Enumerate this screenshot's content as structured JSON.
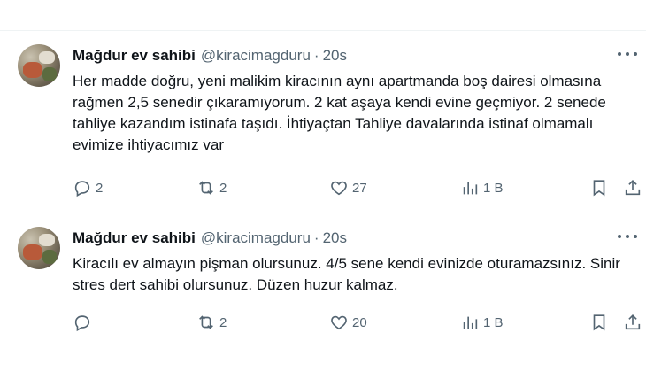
{
  "tweets": [
    {
      "name": "Mağdur ev sahibi",
      "handle": "@kiracimagduru",
      "separator": "·",
      "time": "20s",
      "text": "Her madde doğru, yeni malikim kiracının aynı apartmanda boş dairesi olmasına rağmen 2,5 senedir çıkaramıyorum. 2 kat aşaya kendi evine geçmiyor. 2 senede tahliye kazandım istinafa taşıdı. İhtiyaçtan Tahliye davalarında istinaf olmamalı evimize ihtiyacımız var",
      "replies": "2",
      "retweets": "2",
      "likes": "27",
      "views": "1 B"
    },
    {
      "name": "Mağdur ev sahibi",
      "handle": "@kiracimagduru",
      "separator": "·",
      "time": "20s",
      "text": "Kiracılı ev almayın pişman olursunuz. 4/5 sene kendi evinizde oturamazsınız. Sinir stres dert sahibi olursunuz. Düzen huzur kalmaz.",
      "replies": "",
      "retweets": "2",
      "likes": "20",
      "views": "1 B"
    }
  ],
  "icons": {
    "reply": "reply-icon",
    "retweet": "retweet-icon",
    "like": "heart-icon",
    "views": "views-chart-icon",
    "bookmark": "bookmark-icon",
    "share": "share-icon",
    "more": "more-dots-icon"
  },
  "colors": {
    "text": "#0f1419",
    "secondary": "#536471",
    "divider": "#eff3f4"
  }
}
